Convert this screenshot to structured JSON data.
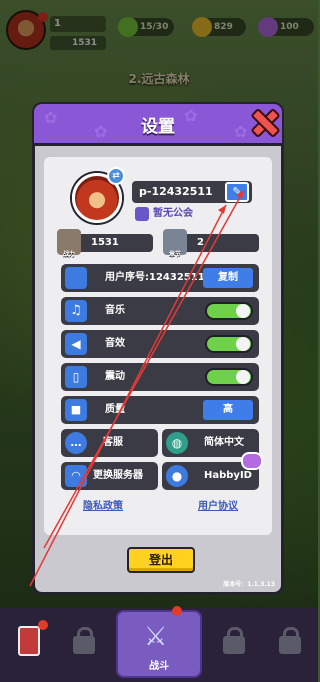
{
  "hud": {
    "level": "1",
    "power": "1531",
    "energy": "15/30",
    "gold": "829",
    "gems": "100"
  },
  "stage": {
    "title": "2.远古森林"
  },
  "dialog": {
    "title": "设置",
    "profile": {
      "player_id": "p-12432511",
      "guild": "暂无公会",
      "power_label": "战力",
      "power_value": "1531",
      "chapter_label": "章节",
      "chapter_value": "2"
    },
    "rows": {
      "user_id_label": "用户序号:12432511",
      "copy_label": "复制",
      "music_label": "音乐",
      "sfx_label": "音效",
      "vibration_label": "震动",
      "quality_label": "质量",
      "quality_value": "高"
    },
    "grid": {
      "service_label": "客服",
      "language_label": "简体中文",
      "server_label": "更换服务器",
      "habby_label": "HabbyID"
    },
    "links": {
      "privacy": "隐私政策",
      "agreement": "用户协议"
    },
    "logout_label": "登出",
    "version": "版本号：1.1.3.13"
  },
  "bottom_nav": {
    "battle_label": "战斗"
  },
  "colors": {
    "header_purple": "#8a57d6",
    "toggle_green": "#6fd14a",
    "button_blue": "#3f7ee8",
    "logout_yellow": "#ffd21f",
    "close_red": "#ef5350",
    "arrow_red": "#e53935"
  }
}
